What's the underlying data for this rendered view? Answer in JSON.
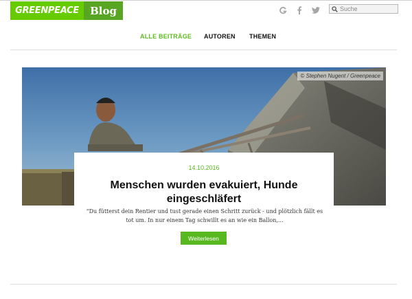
{
  "header": {
    "brand": "GREENPEACE",
    "blog_label": "Blog",
    "social_icons": [
      "google-plus-icon",
      "facebook-icon",
      "twitter-icon"
    ],
    "search": {
      "placeholder": "Suche"
    }
  },
  "nav": {
    "items": [
      {
        "label": "ALLE BEITRÄGE",
        "active": true
      },
      {
        "label": "AUTOREN",
        "active": false
      },
      {
        "label": "THEMEN",
        "active": false
      }
    ]
  },
  "article": {
    "image_credit": "© Stephen Nugent / Greenpeace",
    "date": "14.10.2016",
    "title": "Menschen wurden evakuiert, Hunde eingeschläfert",
    "excerpt": "\"Du fütterst dein Rentier und tust gerade einen Schritt zurück - und plötzlich fällt es tot um. In nur einem Tag schwillt es an wie ein Ballon,...",
    "read_more": "Weiterlesen"
  },
  "colors": {
    "brand_green": "#66cc00",
    "blog_green": "#58a524",
    "accent_green": "#58b820"
  }
}
